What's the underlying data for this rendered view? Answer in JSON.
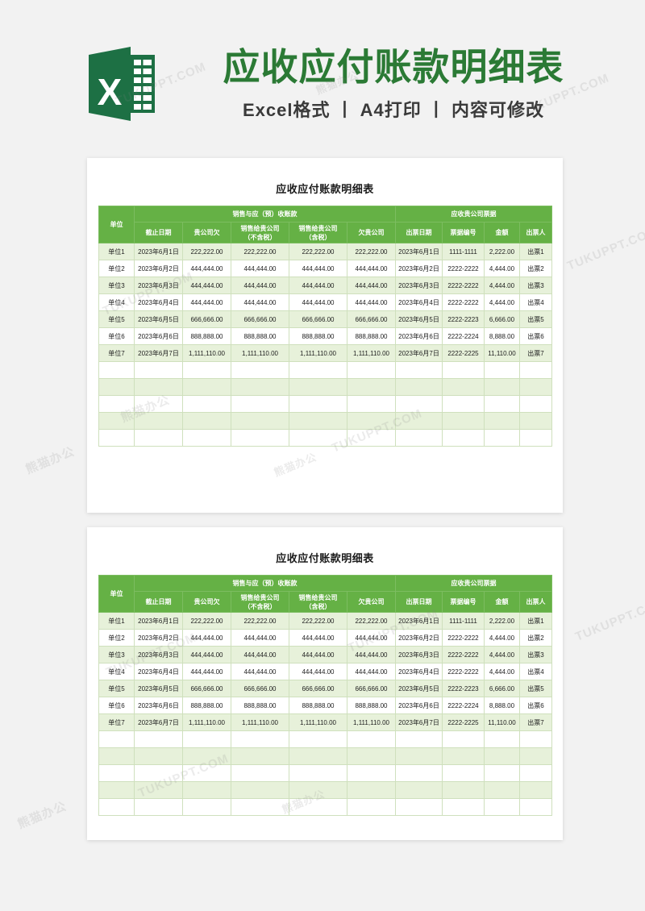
{
  "banner": {
    "logo_icon": "excel-logo-icon",
    "logo_letter": "X",
    "title": "应收应付账款明细表",
    "subtitle": "Excel格式 丨 A4打印 丨 内容可修改",
    "title_color": "#2b7a35",
    "logo_color": "#1d7044"
  },
  "sheet": {
    "title": "应收应付账款明细表",
    "header_color": "#65b145",
    "alt_row_color": "#e7f1da",
    "border_color": "#cfe0bd",
    "group_headers": {
      "unit": "单位",
      "sales": "销售与应（预）收账款",
      "notes": "应收贵公司票据"
    },
    "columns": [
      "单位",
      "截止日期",
      "贵公司欠",
      "销售给贵公司（不含税）",
      "销售给贵公司（含税）",
      "欠贵公司",
      "出票日期",
      "票据编号",
      "金额",
      "出票人"
    ],
    "sub_columns": {
      "deadline": "截止日期",
      "you_owe": "贵公司欠",
      "sale_no_tax_l1": "销售给贵公司",
      "sale_no_tax_l2": "（不含税）",
      "sale_tax_l1": "销售给贵公司",
      "sale_tax_l2": "（含税）",
      "owe_you": "欠贵公司",
      "issue_date": "出票日期",
      "note_no": "票据编号",
      "amount": "金额",
      "drawer": "出票人"
    },
    "rows": [
      {
        "unit": "单位1",
        "deadline": "2023年6月1日",
        "you_owe": "222,222.00",
        "sale_no_tax": "222,222.00",
        "sale_tax": "222,222.00",
        "owe_you": "222,222.00",
        "issue_date": "2023年6月1日",
        "note_no": "1111-1111",
        "amount": "2,222.00",
        "drawer": "出票1"
      },
      {
        "unit": "单位2",
        "deadline": "2023年6月2日",
        "you_owe": "444,444.00",
        "sale_no_tax": "444,444.00",
        "sale_tax": "444,444.00",
        "owe_you": "444,444.00",
        "issue_date": "2023年6月2日",
        "note_no": "2222-2222",
        "amount": "4,444.00",
        "drawer": "出票2"
      },
      {
        "unit": "单位3",
        "deadline": "2023年6月3日",
        "you_owe": "444,444.00",
        "sale_no_tax": "444,444.00",
        "sale_tax": "444,444.00",
        "owe_you": "444,444.00",
        "issue_date": "2023年6月3日",
        "note_no": "2222-2222",
        "amount": "4,444.00",
        "drawer": "出票3"
      },
      {
        "unit": "单位4",
        "deadline": "2023年6月4日",
        "you_owe": "444,444.00",
        "sale_no_tax": "444,444.00",
        "sale_tax": "444,444.00",
        "owe_you": "444,444.00",
        "issue_date": "2023年6月4日",
        "note_no": "2222-2222",
        "amount": "4,444.00",
        "drawer": "出票4"
      },
      {
        "unit": "单位5",
        "deadline": "2023年6月5日",
        "you_owe": "666,666.00",
        "sale_no_tax": "666,666.00",
        "sale_tax": "666,666.00",
        "owe_you": "666,666.00",
        "issue_date": "2023年6月5日",
        "note_no": "2222-2223",
        "amount": "6,666.00",
        "drawer": "出票5"
      },
      {
        "unit": "单位6",
        "deadline": "2023年6月6日",
        "you_owe": "888,888.00",
        "sale_no_tax": "888,888.00",
        "sale_tax": "888,888.00",
        "owe_you": "888,888.00",
        "issue_date": "2023年6月6日",
        "note_no": "2222-2224",
        "amount": "8,888.00",
        "drawer": "出票6"
      },
      {
        "unit": "单位7",
        "deadline": "2023年6月7日",
        "you_owe": "1,111,110.00",
        "sale_no_tax": "1,111,110.00",
        "sale_tax": "1,111,110.00",
        "owe_you": "1,111,110.00",
        "issue_date": "2023年6月7日",
        "note_no": "2222-2225",
        "amount": "11,110.00",
        "drawer": "出票7"
      }
    ],
    "empty_row_count": 5
  },
  "watermarks": {
    "en": "TUKUPPT.COM",
    "cn": "熊猫办公"
  }
}
